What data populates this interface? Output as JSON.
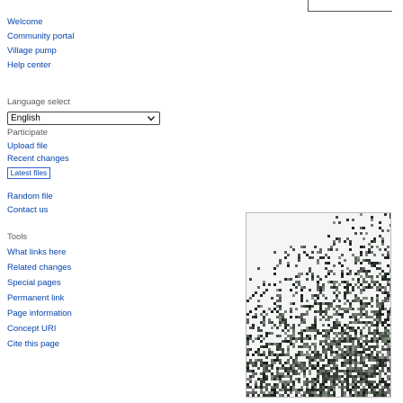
{
  "sidebar": {
    "welcome": "Welcome",
    "navigation": [
      {
        "label": "Community portal"
      },
      {
        "label": "Village pump"
      },
      {
        "label": "Help center"
      }
    ],
    "language": {
      "heading": "Language select",
      "selected": "English"
    },
    "participate": {
      "heading": "Participate",
      "items": [
        {
          "label": "Upload file"
        },
        {
          "label": "Recent changes"
        }
      ],
      "latest_files_button": "Latest files",
      "more_items": [
        {
          "label": "Random file"
        },
        {
          "label": "Contact us"
        }
      ]
    },
    "tools": {
      "heading": "Tools",
      "items": [
        {
          "label": "What links here"
        },
        {
          "label": "Related changes"
        },
        {
          "label": "Special pages"
        },
        {
          "label": "Permanent link"
        },
        {
          "label": "Page information"
        },
        {
          "label": "Concept URI"
        },
        {
          "label": "Cite this page"
        }
      ]
    }
  },
  "colors": {
    "link": "#0645ad",
    "heading": "#54595d",
    "photo_light": "#f5f5f5",
    "photo_dark": "#223322"
  },
  "icons": {
    "dropdown": "chevron-down-icon"
  }
}
